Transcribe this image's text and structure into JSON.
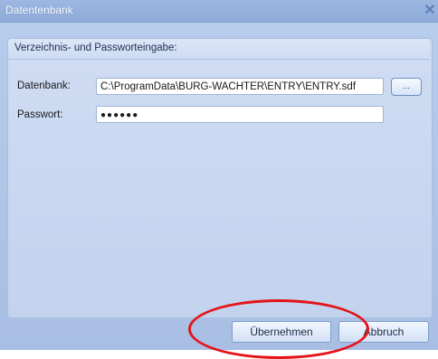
{
  "window": {
    "title": "Datentenbank",
    "close_glyph": "✕"
  },
  "group": {
    "title": "Verzeichnis- und Passworteingabe:"
  },
  "fields": {
    "database_label": "Datenbank:",
    "database_value": "C:\\ProgramData\\BURG-WACHTER\\ENTRY\\ENTRY.sdf",
    "browse_label": "...",
    "password_label": "Passwort:",
    "password_value": "●●●●●●"
  },
  "buttons": {
    "apply_label": "Übernehmen",
    "cancel_label": "Abbruch"
  },
  "colors": {
    "annotation": "#e4141a",
    "title_bar": "#9db7e2",
    "panel": "#c3d3ee"
  }
}
